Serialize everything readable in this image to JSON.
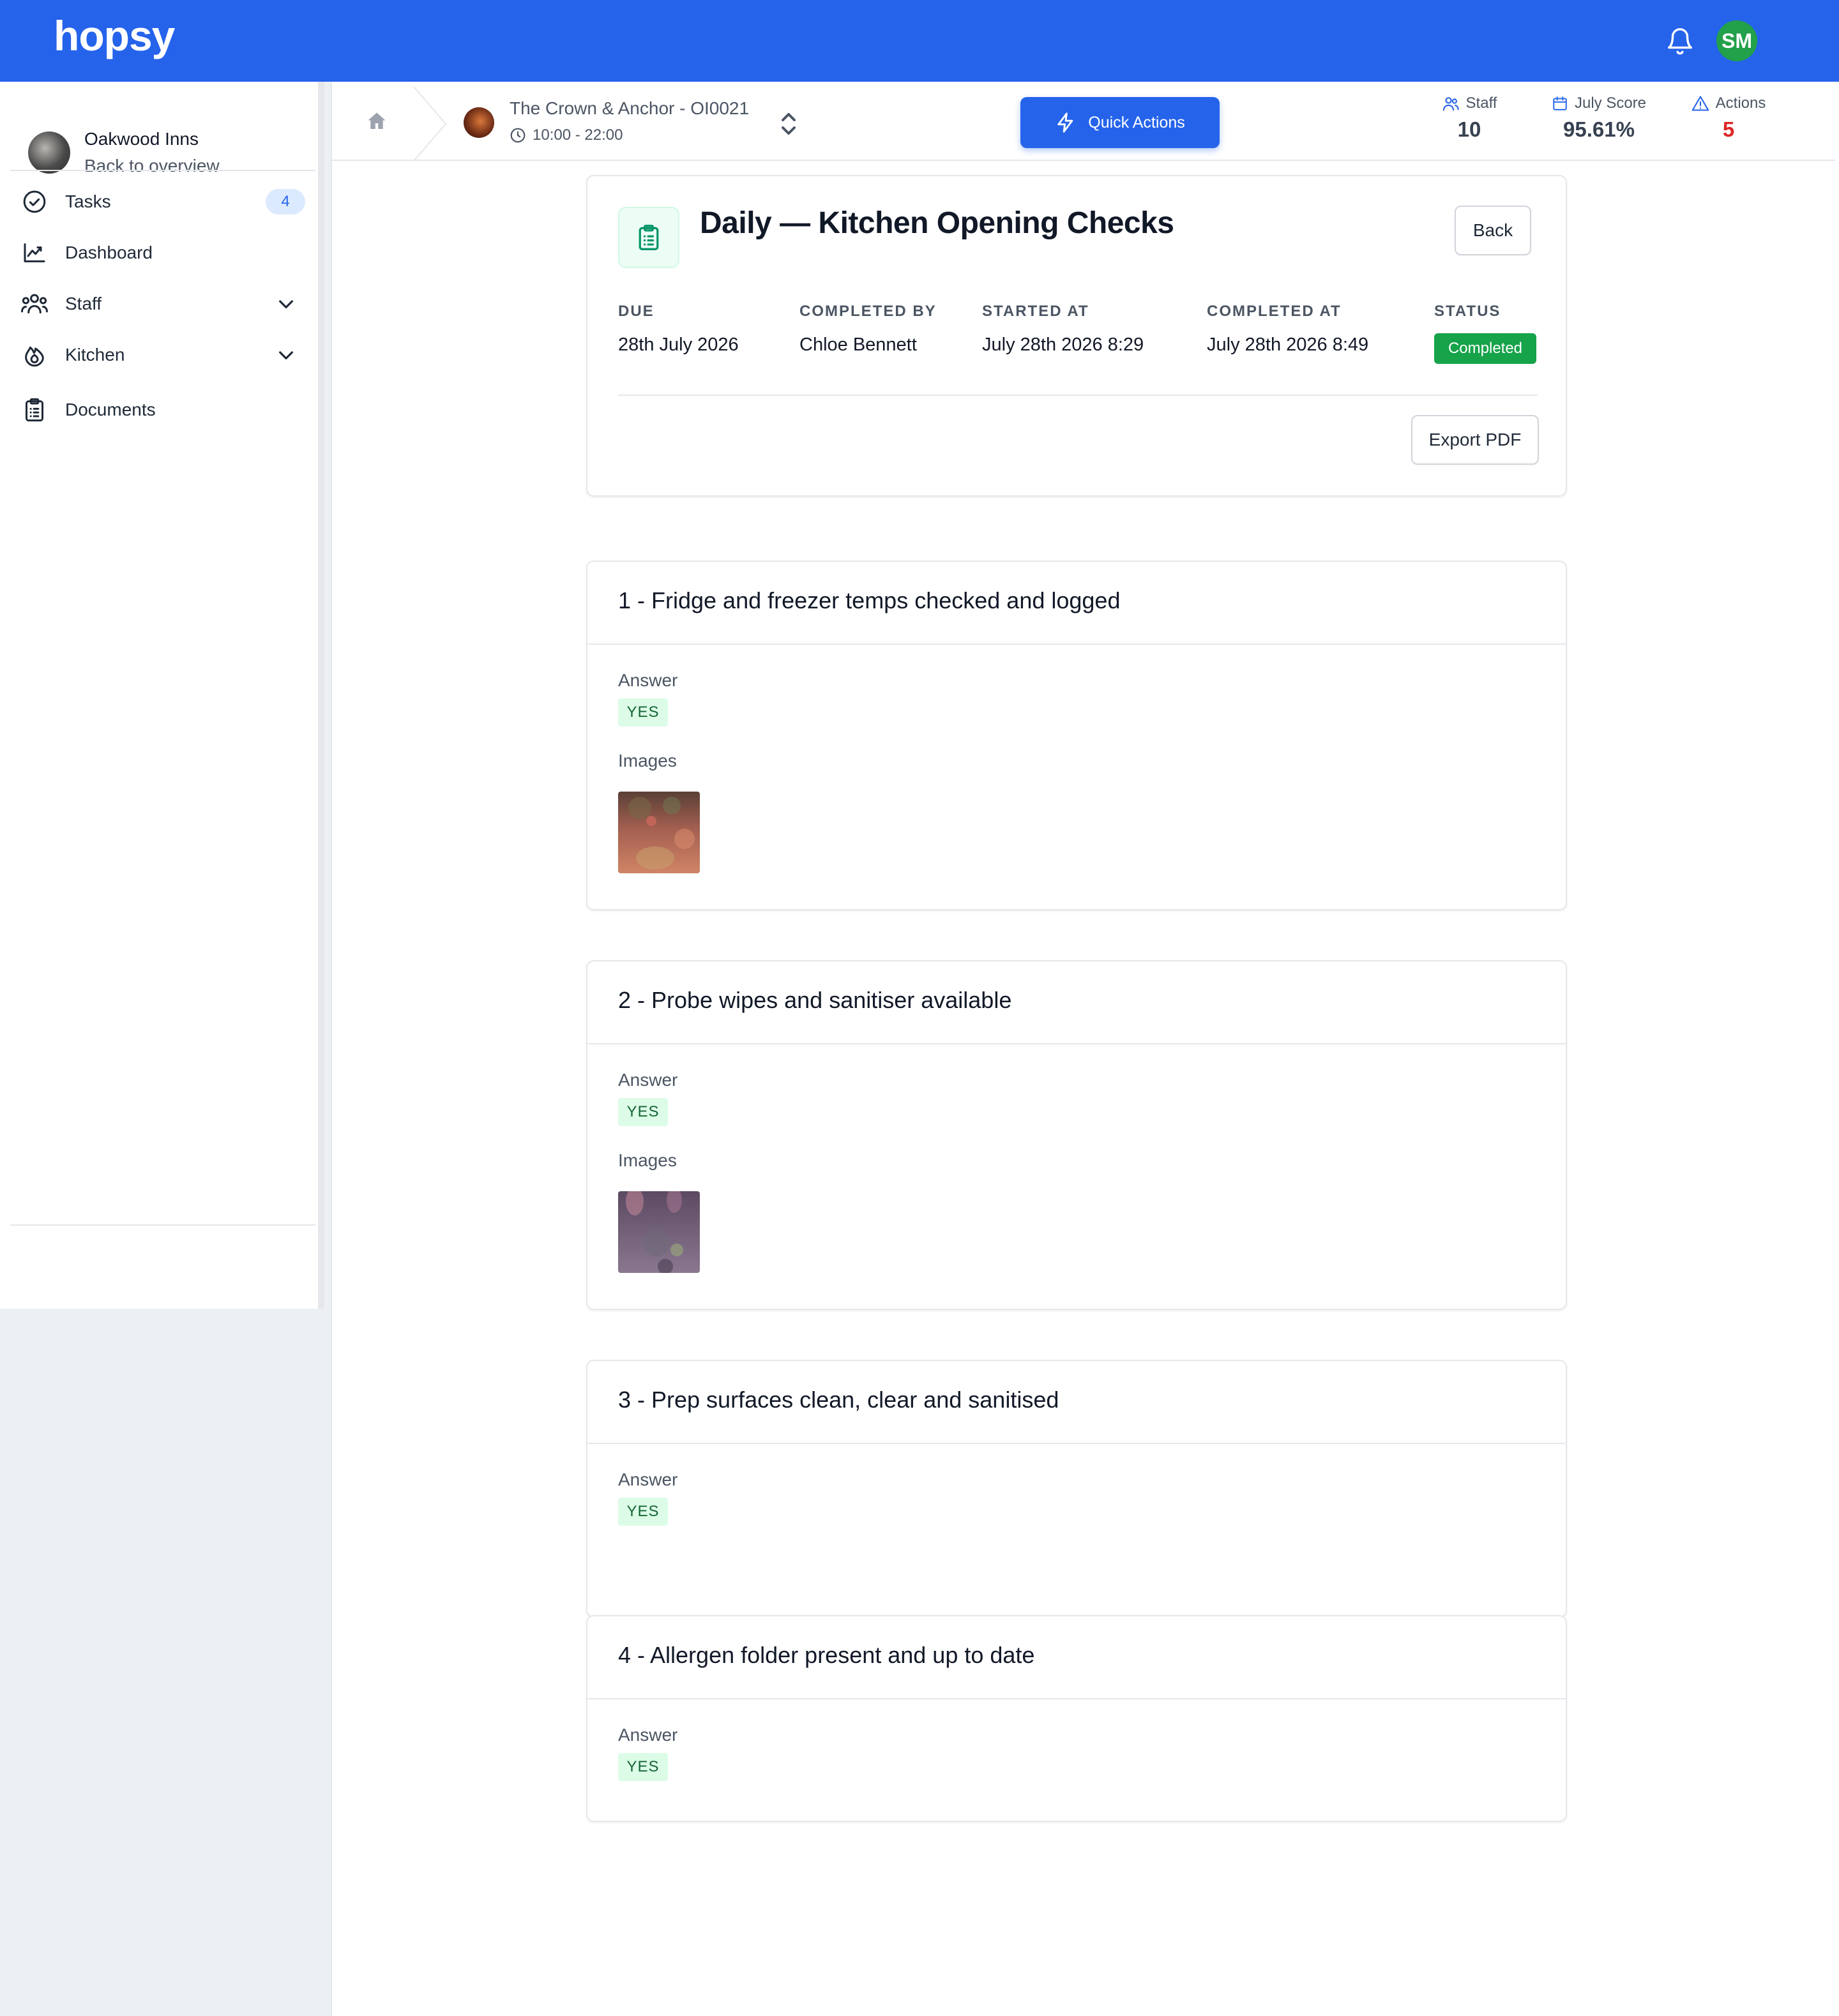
{
  "app": {
    "logo": "hopsy",
    "user_initials": "SM"
  },
  "sidebar": {
    "org_name": "Oakwood Inns",
    "org_back": "Back to overview",
    "items": [
      {
        "label": "Tasks",
        "badge": "4"
      },
      {
        "label": "Dashboard"
      },
      {
        "label": "Staff"
      },
      {
        "label": "Kitchen"
      },
      {
        "label": "Documents"
      }
    ]
  },
  "header": {
    "venue_name": "The Crown & Anchor - OI0021",
    "venue_hours": "10:00 - 22:00",
    "quick_actions_label": "Quick Actions",
    "stats": [
      {
        "label": "Staff",
        "value": "10",
        "color": "#374151"
      },
      {
        "label": "July Score",
        "value": "95.61%",
        "color": "#374151"
      },
      {
        "label": "Actions",
        "value": "5",
        "color": "#dc2626"
      }
    ]
  },
  "task": {
    "title": "Daily — Kitchen Opening Checks",
    "back_label": "Back",
    "export_label": "Export PDF",
    "meta": [
      {
        "label": "DUE",
        "value": "28th July 2026"
      },
      {
        "label": "COMPLETED BY",
        "value": "Chloe Bennett"
      },
      {
        "label": "STARTED AT",
        "value": "July 28th 2026 8:29"
      },
      {
        "label": "COMPLETED AT",
        "value": "July 28th 2026 8:49"
      },
      {
        "label": "STATUS",
        "value": "Completed"
      }
    ]
  },
  "questions": [
    {
      "title": "1 - Fridge and freezer temps checked and logged",
      "answer_label": "Answer",
      "answer": "YES",
      "images_label": "Images"
    },
    {
      "title": "2 - Probe wipes and sanitiser available",
      "answer_label": "Answer",
      "answer": "YES",
      "images_label": "Images"
    },
    {
      "title": "3 - Prep surfaces clean, clear and sanitised",
      "answer_label": "Answer",
      "answer": "YES"
    },
    {
      "title": "4 - Allergen folder present and up to date",
      "answer_label": "Answer",
      "answer": "YES"
    }
  ]
}
